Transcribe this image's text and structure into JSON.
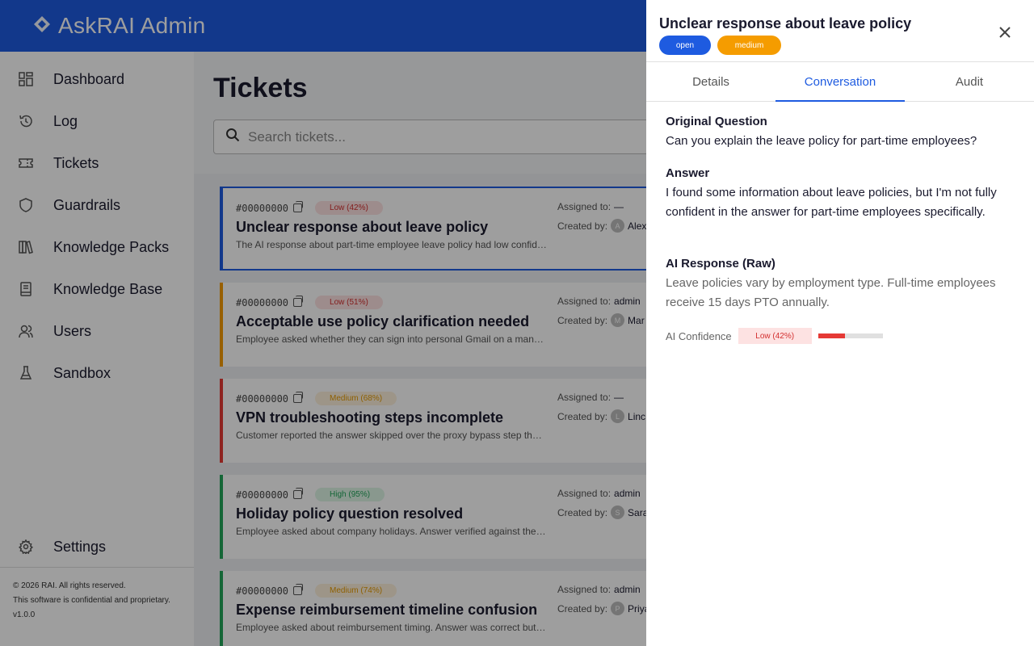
{
  "app": {
    "title": "AskRAI Admin",
    "brand_color": "#1e5be0"
  },
  "sidebar": {
    "items": [
      {
        "label": "Dashboard",
        "icon": "dashboard-icon"
      },
      {
        "label": "Log",
        "icon": "history-icon"
      },
      {
        "label": "Tickets",
        "icon": "ticket-icon"
      },
      {
        "label": "Guardrails",
        "icon": "shield-icon"
      },
      {
        "label": "Knowledge Packs",
        "icon": "books-icon"
      },
      {
        "label": "Knowledge Base",
        "icon": "book-icon"
      },
      {
        "label": "Users",
        "icon": "users-icon"
      },
      {
        "label": "Sandbox",
        "icon": "flask-icon"
      }
    ],
    "settings_label": "Settings",
    "footer": {
      "copyright": "© 2026 RAI. All rights reserved.",
      "notice": "This software is confidential and proprietary.",
      "version": "v1.0.0"
    }
  },
  "main": {
    "title": "Tickets",
    "search_placeholder": "Search tickets..."
  },
  "tickets": [
    {
      "id": "#00000000",
      "confidence": "Low (42%)",
      "level": "low",
      "title": "Unclear response about leave policy",
      "description": "The AI response about part-time employee leave policy had low confidence",
      "assigned_label": "Assigned to:",
      "assigned": "—",
      "created_label": "Created by:",
      "creator_initial": "A",
      "creator": "Alex",
      "border": "#1e5be0"
    },
    {
      "id": "#00000000",
      "confidence": "Low (51%)",
      "level": "low",
      "title": "Acceptable use policy clarification needed",
      "description": "Employee asked whether they can sign into personal Gmail on a managed device",
      "assigned_label": "Assigned to:",
      "assigned": "admin",
      "created_label": "Created by:",
      "creator_initial": "M",
      "creator": "Mar",
      "border": "#f59c00"
    },
    {
      "id": "#00000000",
      "confidence": "Medium (68%)",
      "level": "med",
      "title": "VPN troubleshooting steps incomplete",
      "description": "Customer reported the answer skipped over the proxy bypass step that is required",
      "assigned_label": "Assigned to:",
      "assigned": "—",
      "created_label": "Created by:",
      "creator_initial": "L",
      "creator": "Linc",
      "border": "#e53935"
    },
    {
      "id": "#00000000",
      "confidence": "High (95%)",
      "level": "high",
      "title": "Holiday policy question resolved",
      "description": "Employee asked about company holidays. Answer verified against the handbook",
      "assigned_label": "Assigned to:",
      "assigned": "admin",
      "created_label": "Created by:",
      "creator_initial": "S",
      "creator": "Sara",
      "border": "#22a55a"
    },
    {
      "id": "#00000000",
      "confidence": "Medium (74%)",
      "level": "med",
      "title": "Expense reimbursement timeline confusion",
      "description": "Employee asked about reimbursement timing. Answer was correct but unclear",
      "assigned_label": "Assigned to:",
      "assigned": "admin",
      "created_label": "Created by:",
      "creator_initial": "P",
      "creator": "Priya",
      "border": "#22a55a"
    }
  ],
  "drawer": {
    "title": "Unclear response about leave policy",
    "status_badge": "open",
    "priority_badge": "medium",
    "tabs": [
      "Details",
      "Conversation",
      "Audit"
    ],
    "active_tab": "Conversation",
    "original_question_heading": "Original Question",
    "original_question": "Can you explain the leave policy for part-time employees?",
    "answer_heading": "Answer",
    "answer": "I found some information about leave policies, but I'm not fully confident in the answer for part-time employees specifically.",
    "raw_heading": "AI Response (Raw)",
    "raw_response": "Leave policies vary by employment type. Full-time employees receive 15 days PTO annually.",
    "confidence_label": "AI Confidence",
    "confidence_chip": "Low (42%)",
    "confidence_value": 0.42
  }
}
